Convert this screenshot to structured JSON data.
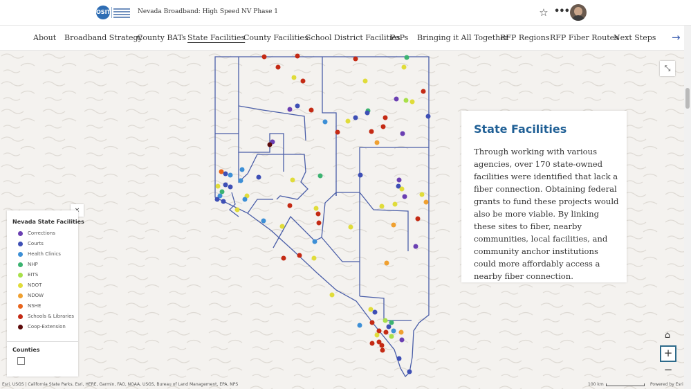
{
  "header": {
    "logo_text": "OSIT",
    "title": "Nevada Broadband: High Speed NV Phase 1",
    "icons": {
      "favorite": "star-outline-icon",
      "more": "more-horizontal-icon"
    }
  },
  "nav": {
    "tabs": [
      {
        "label": "About",
        "active": false
      },
      {
        "label": "Broadband Strategy",
        "active": false
      },
      {
        "label": "County BATs",
        "active": false
      },
      {
        "label": "State Facilities",
        "active": true
      },
      {
        "label": "County Facilities",
        "active": false
      },
      {
        "label": "School District Facilities",
        "active": false
      },
      {
        "label": "PoPs",
        "active": false
      },
      {
        "label": "Bringing it All Together",
        "active": false
      },
      {
        "label": "RFP Regions",
        "active": false
      },
      {
        "label": "RFP Fiber Routes",
        "active": false
      },
      {
        "label": "Next Steps",
        "active": false
      }
    ],
    "next_icon": "→"
  },
  "legend": {
    "title": "Nevada State Facilities",
    "items": [
      {
        "label": "Corrections",
        "color": "#6a3fb2"
      },
      {
        "label": "Courts",
        "color": "#3e4fb5"
      },
      {
        "label": "Health Clinics",
        "color": "#3d8fd6"
      },
      {
        "label": "NHP",
        "color": "#3cb371"
      },
      {
        "label": "EITS",
        "color": "#a8e04a"
      },
      {
        "label": "NDOT",
        "color": "#e0dc3a"
      },
      {
        "label": "NDOW",
        "color": "#f0a030"
      },
      {
        "label": "NSHE",
        "color": "#e8641c"
      },
      {
        "label": "Schools & Libraries",
        "color": "#c42a14"
      },
      {
        "label": "Coop-Extension",
        "color": "#5c0a0a"
      }
    ],
    "counties_title": "Counties",
    "close_label": "×"
  },
  "card": {
    "title": "State Facilities",
    "body": "Through working with various agencies, over 170 state-owned facilities were identified that lack a fiber connection. Obtaining federal grants to fund these projects would also be more viable. By linking these sites to fiber, nearby communities, local facilities, and community anchor institutions could more affordably access a nearby fiber connection."
  },
  "map": {
    "border_color": "#4a5ea8",
    "expand_icon": "⤡",
    "home_icon": "⌂",
    "zoom_in_label": "+",
    "zoom_out_label": "−",
    "attribution": "Esri, USGS | California State Parks, Esri, HERE, Garmin, FAO, NOAA, USGS, Bureau of Land Management, EPA, NPS",
    "scale_label": "100 km",
    "powered_by": "Powered by Esri"
  }
}
